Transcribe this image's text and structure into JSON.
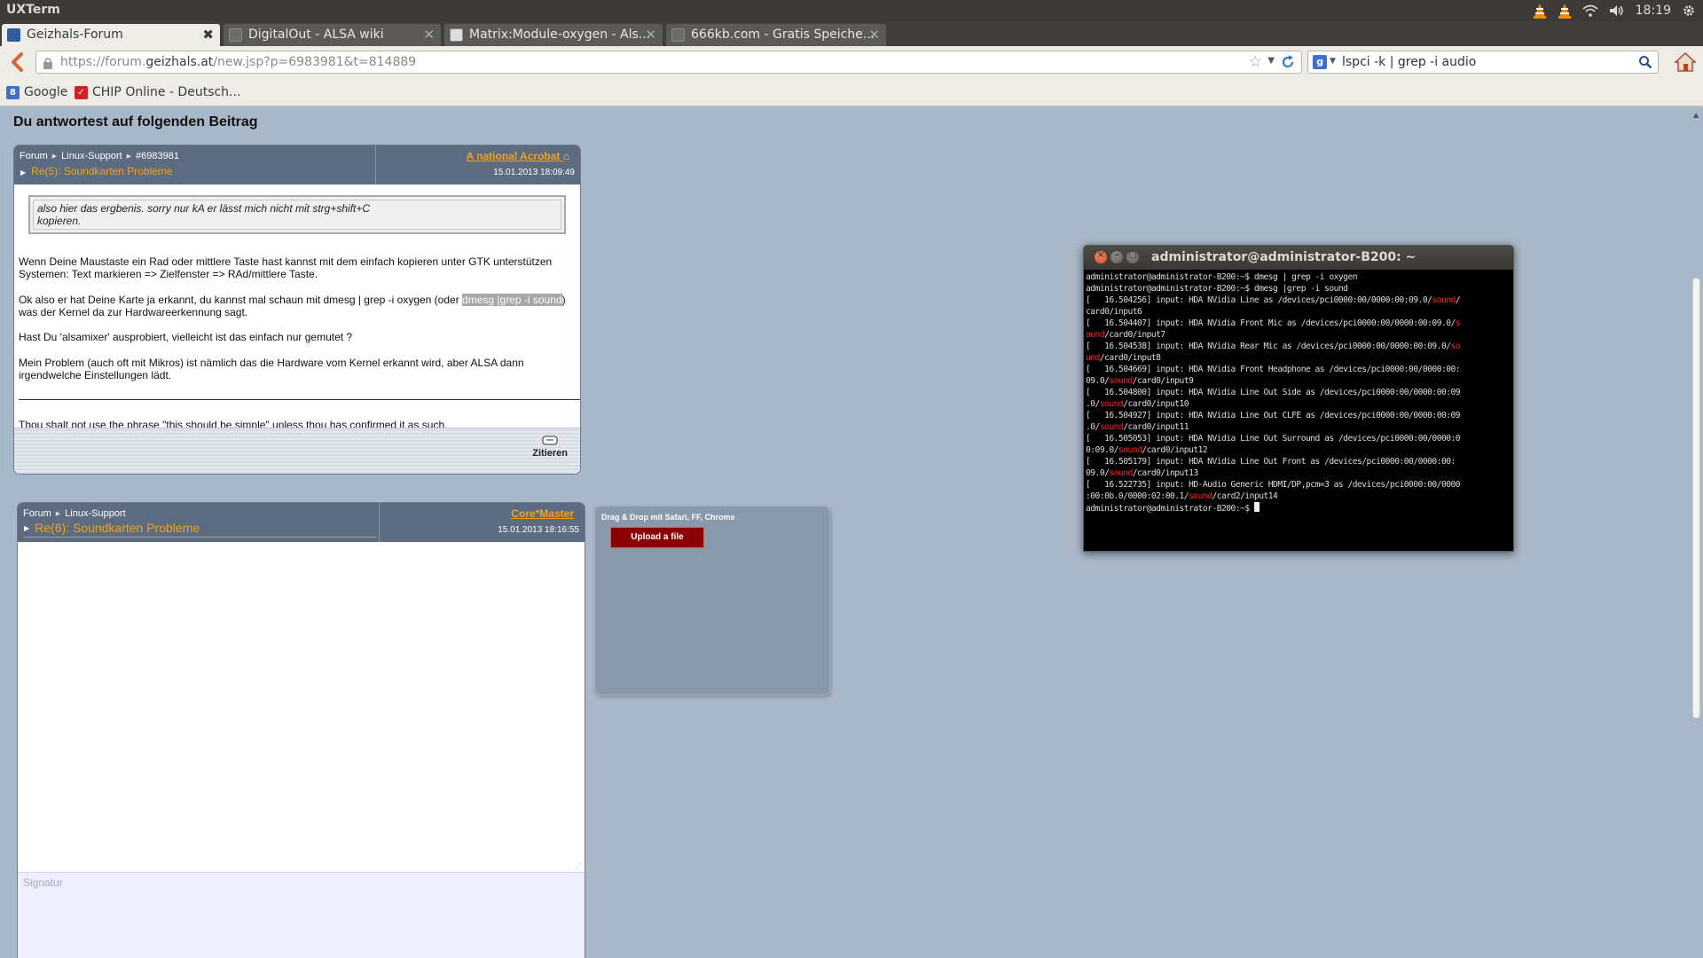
{
  "topbar": {
    "app_title": "UXTerm",
    "clock": "18:19"
  },
  "tabs": [
    {
      "label": "Geizhals-Forum",
      "favicon": "geizhals-favicon",
      "active": true
    },
    {
      "label": "DigitalOut - ALSA wiki",
      "favicon": "page-favicon",
      "active": false
    },
    {
      "label": "Matrix:Module-oxygen - Als...",
      "favicon": "alsa-favicon",
      "active": false
    },
    {
      "label": "666kb.com - Gratis Speiche...",
      "favicon": "page-favicon",
      "active": false
    }
  ],
  "navbar": {
    "url_prefix": "https://forum.",
    "url_domain": "geizhals.at",
    "url_suffix": "/new.jsp?p=6983981&t=814889",
    "search_query": "lspci -k | grep -i audio",
    "search_engine_letter": "g"
  },
  "bookmarks": [
    {
      "label": "Google",
      "icon": "google-icon"
    },
    {
      "label": "CHIP Online - Deutsch...",
      "icon": "chip-icon"
    }
  ],
  "page": {
    "heading": "Du antwortest auf folgenden Beitrag"
  },
  "original_post": {
    "crumbs": [
      "Forum",
      "Linux-Support",
      "#6983981"
    ],
    "subject": "Re(5): Soundkarten Probleme",
    "author": "A national Acrobat",
    "date": "15.01.2013 18:09:49",
    "quote_line1": "also hier das ergbenis. sorry nur kA er lässt mich nicht mit strg+shift+C",
    "quote_line2": "kopieren.",
    "para1_line1": "Wenn Deine Maustaste ein Rad oder mittlere Taste hast kannst mit dem einfach kopieren unter GTK unterstützen",
    "para1_line2": "Systemen: Text markieren => Zielfenster => RAd/mittlere Taste.",
    "para2_before": "Ok also er hat Deine Karte ja erkannt, du kannst mal schaun mit dmesg | grep -i oxygen (oder ",
    "para2_highlight": "dmesg |grep -i sound",
    "para2_after": ")",
    "para2_line2": "was der Kernel da zur Hardwareerkennung sagt.",
    "para3": "Hast Du 'alsamixer' ausprobiert, vielleicht ist das einfach nur gemutet ?",
    "para4_line1": "Mein Problem (auch oft mit Mikros) ist nämlich das die Hardware vom Kernel erkannt wird, aber ALSA dann",
    "para4_line2": "irgendwelche Einstellungen lädt.",
    "signature": "Thou shalt not use the phrase \"this should be simple\" unless thou has confirmed it as such.",
    "quote_button": "Zitieren"
  },
  "reply": {
    "crumbs": [
      "Forum",
      "Linux-Support"
    ],
    "subject": "Re(6): Soundkarten Probleme",
    "author": "Core*Master",
    "date": "15.01.2013 18:16:55",
    "signature_placeholder": "Signatur"
  },
  "upload": {
    "label": "Drag & Drop mit Safari, FF, Chrome",
    "button": "Upload a file"
  },
  "terminal": {
    "title": "administrator@administrator-B200: ~",
    "lines": [
      [
        {
          "t": "administrator@administrator-B200:~$ dmesg | grep -i oxygen"
        }
      ],
      [
        {
          "t": "administrator@administrator-B200:~$ dmesg |grep -i sound"
        }
      ],
      [
        {
          "t": "[   16.504256] input: HDA NVidia Line as /devices/pci0000:00/0000:00:09.0/"
        },
        {
          "t": "sound",
          "red": true
        },
        {
          "t": "/"
        }
      ],
      [
        {
          "t": "card0/input6"
        }
      ],
      [
        {
          "t": "[   16.504407] input: HDA NVidia Front Mic as /devices/pci0000:00/0000:00:09.0/"
        },
        {
          "t": "s",
          "red": true
        }
      ],
      [
        {
          "t": "ound",
          "red": true
        },
        {
          "t": "/card0/input7"
        }
      ],
      [
        {
          "t": "[   16.504538] input: HDA NVidia Rear Mic as /devices/pci0000:00/0000:00:09.0/"
        },
        {
          "t": "so",
          "red": true
        }
      ],
      [
        {
          "t": "und",
          "red": true
        },
        {
          "t": "/card0/input8"
        }
      ],
      [
        {
          "t": "[   16.504669] input: HDA NVidia Front Headphone as /devices/pci0000:00/0000:00:"
        }
      ],
      [
        {
          "t": "09.0/"
        },
        {
          "t": "sound",
          "red": true
        },
        {
          "t": "/card0/input9"
        }
      ],
      [
        {
          "t": "[   16.504800] input: HDA NVidia Line Out Side as /devices/pci0000:00/0000:00:09"
        }
      ],
      [
        {
          "t": ".0/"
        },
        {
          "t": "sound",
          "red": true
        },
        {
          "t": "/card0/input10"
        }
      ],
      [
        {
          "t": "[   16.504927] input: HDA NVidia Line Out CLFE as /devices/pci0000:00/0000:00:09"
        }
      ],
      [
        {
          "t": ".0/"
        },
        {
          "t": "sound",
          "red": true
        },
        {
          "t": "/card0/input11"
        }
      ],
      [
        {
          "t": "[   16.505053] input: HDA NVidia Line Out Surround as /devices/pci0000:00/0000:0"
        }
      ],
      [
        {
          "t": "0:09.0/"
        },
        {
          "t": "sound",
          "red": true
        },
        {
          "t": "/card0/input12"
        }
      ],
      [
        {
          "t": "[   16.505179] input: HDA NVidia Line Out Front as /devices/pci0000:00/0000:00:"
        }
      ],
      [
        {
          "t": "09.0/"
        },
        {
          "t": "sound",
          "red": true
        },
        {
          "t": "/card0/input13"
        }
      ],
      [
        {
          "t": "[   16.522735] input: HD-Audio Generic HDMI/DP,pcm=3 as /devices/pci0000:00/0000"
        }
      ],
      [
        {
          "t": ":00:0b.0/0000:02:00.1/"
        },
        {
          "t": "sound",
          "red": true
        },
        {
          "t": "/card2/input14"
        }
      ],
      [
        {
          "t": "administrator@administrator-B200:~$ "
        },
        {
          "cursor": true
        }
      ]
    ]
  },
  "colors": {
    "page_bg": "#a9b8c9",
    "post_header": "#5c6b80",
    "accent_orange": "#f3a318",
    "upload_button": "#8b0000",
    "terminal_red": "#ff2020"
  }
}
